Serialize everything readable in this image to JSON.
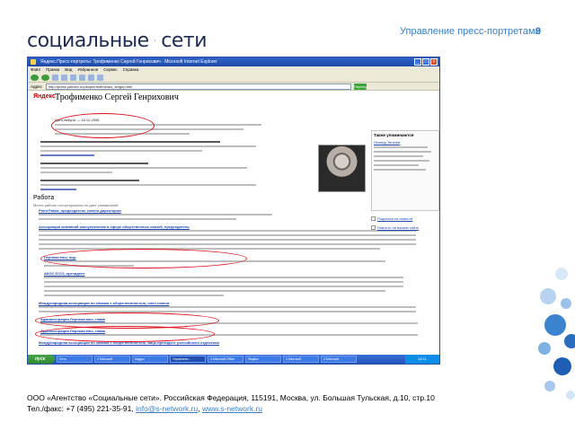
{
  "logo": {
    "word_left": "социальные",
    "word_right": "сети"
  },
  "slide": {
    "title": "Управление пресс-портретами",
    "number": "9"
  },
  "browser": {
    "window_title": "Яндекс.Пресс-портреты: Трофименко Сергей Генрихович - Microsoft Internet Explorer",
    "menu": [
      "Файл",
      "Правка",
      "Вид",
      "Избранное",
      "Сервис",
      "Справка"
    ],
    "address_label": "Адрес",
    "address": "http://press.yandex.ru/people/trofimenko_sergej.html",
    "go_label": "Переход"
  },
  "page": {
    "site_logo": "Яндекс",
    "person_name": "Трофименко Сергей Генрихович",
    "nav": "Портреты · Все персоны · Трофименко Сергей Генрихович",
    "date_label": "Дата cмерти — 16.12.2005",
    "section_work": "Работа",
    "section_work_sub": "Места работы отсортированы по дате упоминаний",
    "work_entries": [
      "Point Pakaz, председатель совета директоров",
      "Ассоциация компаний консультантов в сфере общественных связей, председатель",
      "Лернмостмы, мэр",
      "АКОС ICCO, президент",
      "Международная ассоциация по связям с общественностью, член совета",
      "Администрация Лернмостмы, глава",
      "Администрация Лернмостмы, глава",
      "Международная ассоциация по связям с общественностью, вице-президент российского отделения"
    ],
    "sidebar_title": "Также упоминаются",
    "sidebar_name": "Леонид Тягачев",
    "sidebar_links": [
      "Подписка на новости",
      "Новости на вашем сайте"
    ]
  },
  "taskbar": {
    "start": "пуск",
    "tasks": [
      "Сеть",
      "2 Microsoft",
      "Кадры",
      "Управлени...",
      "4 Microsoft Office",
      "Яндекс",
      "2 Microsoft",
      "2 Microsoft",
      "Сообщени..."
    ],
    "clock": "18:11"
  },
  "footer": {
    "line1": "ООО «Агентство «Социальные сети». Российская Федерация, 115191, Москва, ул. Большая Тульская, д.10, стр.10",
    "phone_prefix": "Тел./факс: +7 (495) 221-35-91, ",
    "email": "info@s-network.ru",
    "separator": ", ",
    "website": "www.s-network.ru"
  },
  "colors": {
    "accent": "#3b7fc4",
    "brand_dark": "#1d2c55",
    "highlight": "#e0101a"
  }
}
